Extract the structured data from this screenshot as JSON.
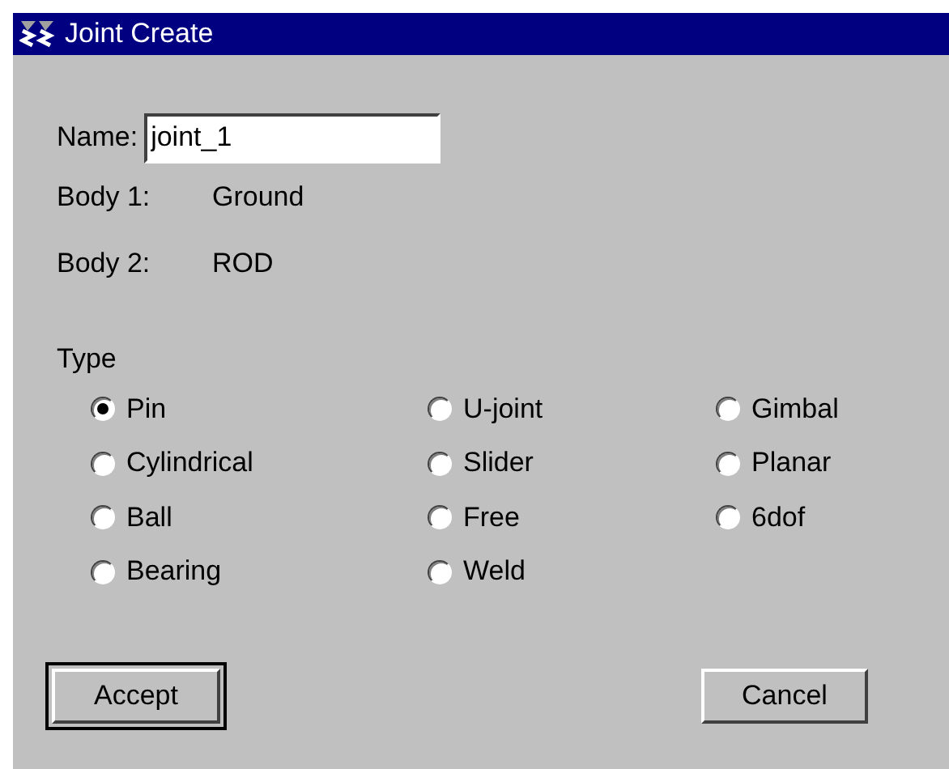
{
  "window": {
    "title": "Joint Create"
  },
  "name": {
    "label": "Name:",
    "value": "joint_1"
  },
  "bodies": [
    {
      "label": "Body 1:",
      "value": "Ground"
    },
    {
      "label": "Body 2:",
      "value": "ROD"
    }
  ],
  "type": {
    "label": "Type",
    "options": [
      {
        "label": "Pin",
        "selected": true
      },
      {
        "label": "U-joint",
        "selected": false
      },
      {
        "label": "Gimbal",
        "selected": false
      },
      {
        "label": "Cylindrical",
        "selected": false
      },
      {
        "label": "Slider",
        "selected": false
      },
      {
        "label": "Planar",
        "selected": false
      },
      {
        "label": "Ball",
        "selected": false
      },
      {
        "label": "Free",
        "selected": false
      },
      {
        "label": "6dof",
        "selected": false
      },
      {
        "label": "Bearing",
        "selected": false
      },
      {
        "label": "Weld",
        "selected": false
      }
    ]
  },
  "buttons": [
    {
      "label": "Accept",
      "default": true
    },
    {
      "label": "Cancel",
      "default": false
    }
  ]
}
